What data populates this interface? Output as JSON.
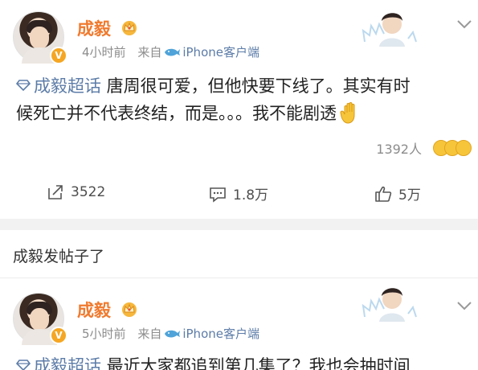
{
  "post1": {
    "author": "成毅",
    "time": "4小时前",
    "from_prefix": "来自",
    "source": "iPhone客户端",
    "topic": "成毅超话",
    "text_line1": " 唐周很可爱，但他快要下线了。其实有时",
    "text_line2": "候死亡并不代表终结，而是。。。我不能剧透",
    "reaction_count": "1392人",
    "repost_count": "3522",
    "comment_count": "1.8万",
    "like_count": "5万"
  },
  "section": {
    "title": "成毅发帖子了"
  },
  "post2": {
    "author": "成毅",
    "time": "5小时前",
    "from_prefix": "来自",
    "source": "iPhone客户端",
    "topic": "成毅超话",
    "text_line1": " 最近大家都追到第几集了？我也会抽时间"
  },
  "colors": {
    "name": "#f07a2e",
    "link": "#5c7ca8",
    "meta": "#8c8c8c",
    "divider": "#f2f2f2"
  },
  "icons": [
    "verified-badge-icon",
    "crown-icon",
    "whale-icon",
    "chevron-down-icon",
    "diamond-icon",
    "repost-icon",
    "comment-icon",
    "thumbs-up-icon",
    "wave-hand-icon",
    "emoji-icon"
  ]
}
